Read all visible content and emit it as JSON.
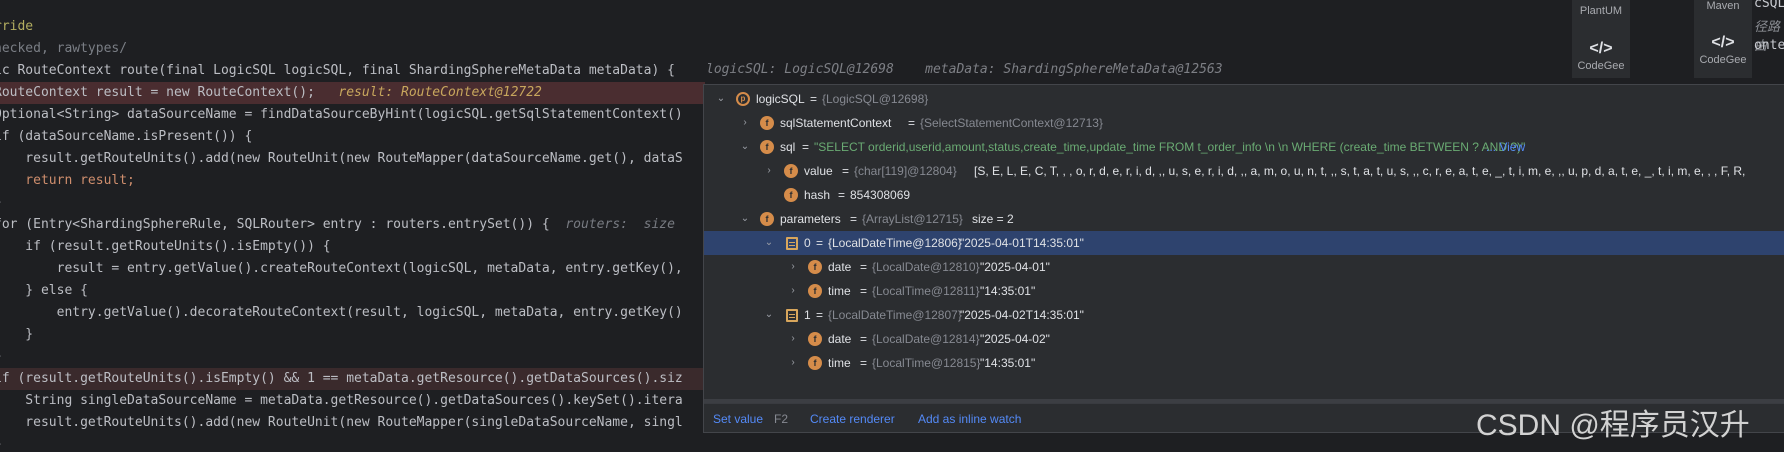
{
  "editor": {
    "lines": [
      {
        "text": "rride"
      },
      {
        "text": "hecked, rawtypes/"
      },
      {
        "text": "ic RouteContext route(final LogicSQL logicSQL, final ShardingSphereMetaData metaData) {"
      },
      {
        "text": "RouteContext result = new RouteContext();",
        "hint": "result: RouteContext@12722"
      },
      {
        "text": "Optional<String> dataSourceName = findDataSourceByHint(logicSQL.getSqlStatementContext()"
      },
      {
        "text": "if (dataSourceName.isPresent()) {"
      },
      {
        "text": "    result.getRouteUnits().add(new RouteUnit(new RouteMapper(dataSourceName.get(), dataS"
      },
      {
        "text": "    return result;"
      },
      {
        "text": "}"
      },
      {
        "text": "for (Entry<ShardingSphereRule, SQLRouter> entry : routers.entrySet()) {",
        "hint": "routers:  size"
      },
      {
        "text": "    if (result.getRouteUnits().isEmpty()) {"
      },
      {
        "text": "        result = entry.getValue().createRouteContext(logicSQL, metaData, entry.getKey(),"
      },
      {
        "text": "    } else {"
      },
      {
        "text": "        entry.getValue().decorateRouteContext(result, logicSQL, metaData, entry.getKey()"
      },
      {
        "text": "    }"
      },
      {
        "text": "}"
      },
      {
        "text": "if (result.getRouteUnits().isEmpty() && 1 == metaData.getResource().getDataSources().siz"
      },
      {
        "text": "    String singleDataSourceName = metaData.getResource().getDataSources().keySet().itera"
      },
      {
        "text": "    result.getRouteUnits().add(new RouteUnit(new RouteMapper(singleDataSourceName, singl"
      },
      {
        "text": "}"
      }
    ],
    "inline_hint": "logicSQL: LogicSQL@12698    metaData: ShardingSphereMetaData@12563"
  },
  "toolbar": {
    "plantuml_label": "PlantUM",
    "codegeex_label_1": "CodeGee",
    "maven_label": "Maven",
    "codegeex_label_2": "CodeGee",
    "right_edge_text": [
      "cSQL",
      "径路由",
      "onte"
    ]
  },
  "debugger": {
    "tree": [
      {
        "label": "logicSQL",
        "ref": "{LogicSQL@12698}",
        "value": ""
      },
      {
        "label": "sqlStatementContext",
        "ref": "{SelectStatementContext@12713}",
        "value": ""
      },
      {
        "label": "sql",
        "ref": "",
        "value": "\"SELECT  orderid,userid,amount,status,create_time,update_time  FROM t_order_info \\n \\n WHERE (create_time BETWEEN ? AND ?)\"",
        "link": "... View"
      },
      {
        "label": "value",
        "ref": "{char[119]@12804}",
        "value": "[S, E, L, E, C, T,  ,  , o, r, d, e, r, i, d, ,, u, s, e, r, i, d, ,, a, m, o, u, n, t, ,, s, t, a, t, u, s, ,, c, r, e, a, t, e, _, t, i, m, e, ,, u, p, d, a, t, e, _, t, i, m, e,  ,  , F, R,"
      },
      {
        "label": "hash",
        "ref": "",
        "value": "854308069"
      },
      {
        "label": "parameters",
        "ref": "{ArrayList@12715}",
        "value": "size = 2"
      },
      {
        "label": "0",
        "ref": "{LocalDateTime@12806}",
        "value": "\"2025-04-01T14:35:01\""
      },
      {
        "label": "date",
        "ref": "{LocalDate@12810}",
        "value": "\"2025-04-01\""
      },
      {
        "label": "time",
        "ref": "{LocalTime@12811}",
        "value": "\"14:35:01\""
      },
      {
        "label": "1",
        "ref": "{LocalDateTime@12807}",
        "value": "\"2025-04-02T14:35:01\""
      },
      {
        "label": "date",
        "ref": "{LocalDate@12814}",
        "value": "\"2025-04-02\""
      },
      {
        "label": "time",
        "ref": "{LocalTime@12815}",
        "value": "\"14:35:01\""
      }
    ],
    "footer": {
      "set_value": "Set value",
      "set_value_key": "F2",
      "create_renderer": "Create renderer",
      "add_inline_watch": "Add as inline watch"
    }
  },
  "watermark": "CSDN @程序员汉升",
  "colors": {
    "editor_bg": "#1e1f22",
    "popup_bg": "#2b2d30",
    "selection": "#2e436e",
    "string": "#6aab73",
    "link": "#548af7"
  }
}
